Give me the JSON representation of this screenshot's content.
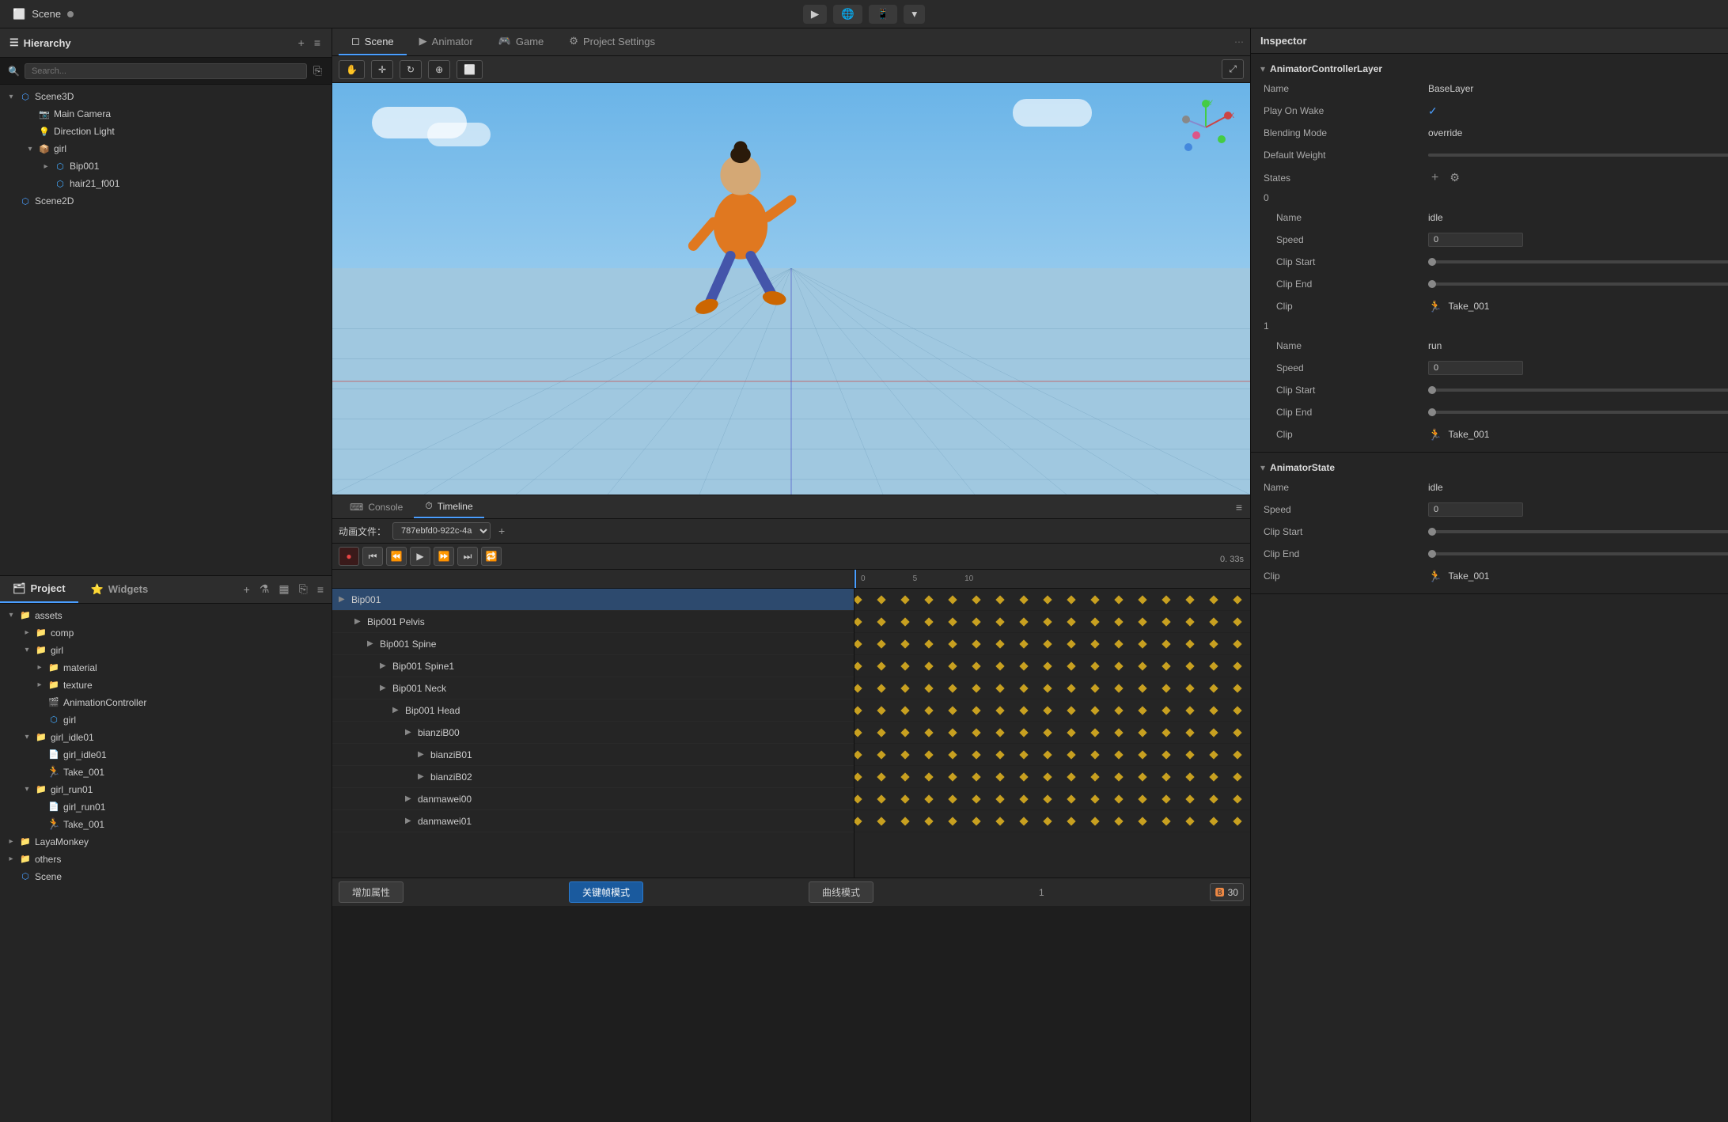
{
  "titlebar": {
    "scene_name": "Scene",
    "play_btn": "▶",
    "globe_btn": "🌐",
    "device_btn": "📱",
    "dropdown_btn": "▾"
  },
  "hierarchy": {
    "title": "Hierarchy",
    "search_placeholder": "Search...",
    "items": [
      {
        "id": "scene3d",
        "label": "Scene3D",
        "depth": 0,
        "arrow": "▾",
        "icon": "scene",
        "expanded": true
      },
      {
        "id": "main-camera",
        "label": "Main Camera",
        "depth": 1,
        "arrow": "",
        "icon": "camera"
      },
      {
        "id": "direction-light",
        "label": "Direction Light",
        "depth": 1,
        "arrow": "",
        "icon": "light"
      },
      {
        "id": "girl",
        "label": "girl",
        "depth": 1,
        "arrow": "▾",
        "icon": "mesh",
        "expanded": true
      },
      {
        "id": "bip001",
        "label": "Bip001",
        "depth": 2,
        "arrow": "▸",
        "icon": "mesh"
      },
      {
        "id": "hair21",
        "label": "hair21_f001",
        "depth": 2,
        "arrow": "",
        "icon": "mesh"
      },
      {
        "id": "scene2d",
        "label": "Scene2D",
        "depth": 0,
        "arrow": "",
        "icon": "scene"
      }
    ]
  },
  "project": {
    "tab1": "Project",
    "tab2": "Widgets",
    "items": [
      {
        "id": "assets",
        "label": "assets",
        "depth": 0,
        "arrow": "▾",
        "icon": "folder",
        "expanded": true
      },
      {
        "id": "comp",
        "label": "comp",
        "depth": 1,
        "arrow": "▸",
        "icon": "folder"
      },
      {
        "id": "girl-folder",
        "label": "girl",
        "depth": 1,
        "arrow": "▾",
        "icon": "folder",
        "expanded": true
      },
      {
        "id": "material",
        "label": "material",
        "depth": 2,
        "arrow": "▸",
        "icon": "folder"
      },
      {
        "id": "texture",
        "label": "texture",
        "depth": 2,
        "arrow": "▸",
        "icon": "folder"
      },
      {
        "id": "animcontroller",
        "label": "AnimationController",
        "depth": 2,
        "arrow": "",
        "icon": "anim"
      },
      {
        "id": "girl-asset",
        "label": "girl",
        "depth": 2,
        "arrow": "",
        "icon": "mesh"
      },
      {
        "id": "girl-idle01",
        "label": "girl_idle01",
        "depth": 1,
        "arrow": "▾",
        "icon": "folder",
        "expanded": true
      },
      {
        "id": "girl-idle01-file",
        "label": "girl_idle01",
        "depth": 2,
        "arrow": "",
        "icon": "anim"
      },
      {
        "id": "take001-1",
        "label": "Take_001",
        "depth": 2,
        "arrow": "",
        "icon": "clip"
      },
      {
        "id": "girl-run01",
        "label": "girl_run01",
        "depth": 1,
        "arrow": "▾",
        "icon": "folder",
        "expanded": true
      },
      {
        "id": "girl-run01-file",
        "label": "girl_run01",
        "depth": 2,
        "arrow": "",
        "icon": "anim"
      },
      {
        "id": "take001-2",
        "label": "Take_001",
        "depth": 2,
        "arrow": "",
        "icon": "clip"
      },
      {
        "id": "layamonkey",
        "label": "LayaMonkey",
        "depth": 0,
        "arrow": "▸",
        "icon": "folder"
      },
      {
        "id": "others",
        "label": "others",
        "depth": 0,
        "arrow": "▸",
        "icon": "folder"
      },
      {
        "id": "scene-file",
        "label": "Scene",
        "depth": 0,
        "arrow": "",
        "icon": "scene"
      }
    ]
  },
  "editor_tabs": [
    {
      "id": "scene",
      "label": "Scene",
      "active": true,
      "icon": "◻"
    },
    {
      "id": "animator",
      "label": "Animator",
      "active": false,
      "icon": "▶"
    },
    {
      "id": "game",
      "label": "Game",
      "active": false,
      "icon": "🎮"
    },
    {
      "id": "project-settings",
      "label": "Project Settings",
      "active": false,
      "icon": "⚙"
    }
  ],
  "timeline": {
    "console_tab": "Console",
    "timeline_tab": "Timeline",
    "anim_file_label": "动画文件：",
    "anim_file_value": "787ebfd0-922c-4a",
    "time_display": "0. 33s",
    "tracks": [
      {
        "label": "Bip001",
        "depth": 0,
        "arrow": "▶",
        "highlighted": true
      },
      {
        "label": "Bip001 Pelvis",
        "depth": 1,
        "arrow": "▶"
      },
      {
        "label": "Bip001 Spine",
        "depth": 2,
        "arrow": "▶"
      },
      {
        "label": "Bip001 Spine1",
        "depth": 2,
        "arrow": "▶"
      },
      {
        "label": "Bip001 Neck",
        "depth": 2,
        "arrow": "▶"
      },
      {
        "label": "Bip001 Head",
        "depth": 2,
        "arrow": "▶"
      },
      {
        "label": "bianziB00",
        "depth": 3,
        "arrow": "▶"
      },
      {
        "label": "bianziB01",
        "depth": 4,
        "arrow": "▶"
      },
      {
        "label": "bianziB02",
        "depth": 4,
        "arrow": "▶"
      },
      {
        "label": "danmawei00",
        "depth": 3,
        "arrow": "▶"
      },
      {
        "label": "danmawei01",
        "depth": 3,
        "arrow": "▶"
      }
    ],
    "ruler_marks": [
      "0",
      "5",
      "10"
    ],
    "footer": {
      "add_prop": "增加属性",
      "keyframe_mode": "关键帧模式",
      "curve_mode": "曲线模式",
      "frame_count": "1",
      "fps": "30"
    }
  },
  "inspector": {
    "title": "Inspector",
    "sections": [
      {
        "id": "animator-controller-layer",
        "title": "AnimatorControllerLayer",
        "props": [
          {
            "label": "Name",
            "value": "BaseLayer",
            "type": "text"
          },
          {
            "label": "Play On Wake",
            "value": "✓",
            "type": "check"
          },
          {
            "label": "Blending Mode",
            "value": "override",
            "type": "text"
          },
          {
            "label": "Default Weight",
            "value": "",
            "type": "slider"
          }
        ],
        "states_label": "States",
        "states": [
          {
            "number": "0",
            "props": [
              {
                "label": "Name",
                "value": "idle",
                "type": "text"
              },
              {
                "label": "Speed",
                "value": "0",
                "type": "input"
              },
              {
                "label": "Clip Start",
                "value": "",
                "type": "slider"
              },
              {
                "label": "Clip End",
                "value": "",
                "type": "slider"
              },
              {
                "label": "Clip",
                "value": "Take_001",
                "type": "clip"
              }
            ]
          },
          {
            "number": "1",
            "props": [
              {
                "label": "Name",
                "value": "run",
                "type": "text"
              },
              {
                "label": "Speed",
                "value": "0",
                "type": "input"
              },
              {
                "label": "Clip Start",
                "value": "",
                "type": "slider"
              },
              {
                "label": "Clip End",
                "value": "",
                "type": "slider"
              },
              {
                "label": "Clip",
                "value": "Take_001",
                "type": "clip"
              }
            ]
          }
        ]
      },
      {
        "id": "animator-state",
        "title": "AnimatorState",
        "props": [
          {
            "label": "Name",
            "value": "idle",
            "type": "text"
          },
          {
            "label": "Speed",
            "value": "0",
            "type": "input"
          },
          {
            "label": "Clip Start",
            "value": "",
            "type": "slider"
          },
          {
            "label": "Clip End",
            "value": "",
            "type": "slider"
          },
          {
            "label": "Clip",
            "value": "Take_001",
            "type": "clip"
          }
        ]
      }
    ]
  }
}
